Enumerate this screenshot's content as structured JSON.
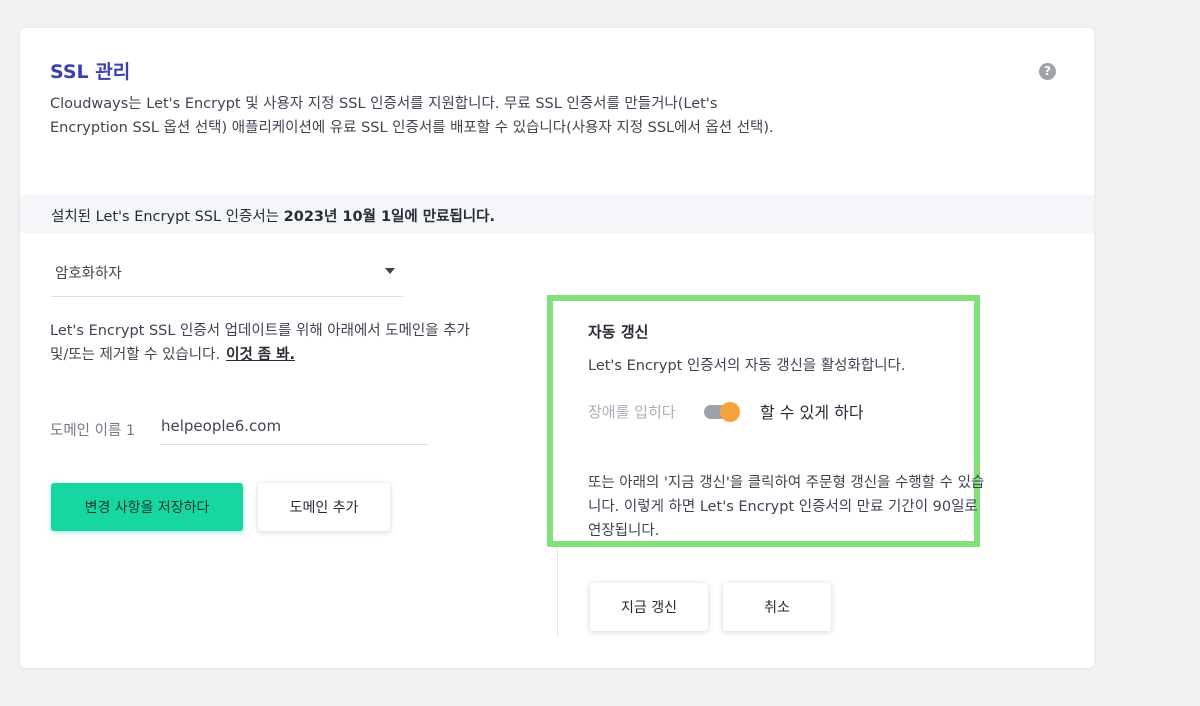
{
  "ssl": {
    "title": "SSL 관리",
    "help_icon": "?",
    "description": "Cloudways는 Let's Encrypt 및 사용자 지정 SSL 인증서를 지원합니다. 무료 SSL 인증서를 만들거나(Let's Encryption SSL 옵션 선택) 애플리케이션에 유료 SSL 인증서를 배포할 수 있습니다(사용자 지정 SSL에서 옵션 선택).",
    "expiry_prefix": "설치된 Let's Encrypt SSL 인증서는 ",
    "expiry_date": "2023년 10월 1일에 만료됩니다."
  },
  "certificate_select": {
    "value": "암호화하자"
  },
  "domains": {
    "help_text": "Let's Encrypt SSL 인증서 업데이트를 위해 아래에서 도메인을 추가 및/또는 제거할 수 있습니다.",
    "see_link": "이것 좀 봐.",
    "label": "도메인 이름 1",
    "value": "helpeople6.com"
  },
  "buttons": {
    "save": "변경 사항을 저장하다",
    "add_domain": "도메인 추가",
    "renew_now": "지금 갱신",
    "cancel": "취소"
  },
  "auto_renew": {
    "title": "자동 갱신",
    "subtitle": "Let's Encrypt 인증서의 자동 갱신을 활성화합니다.",
    "off_label": "장애를 입히다",
    "on_label": "할 수 있게 하다",
    "enabled": true,
    "note": "또는 아래의 '지금 갱신'을 클릭하여 주문형 갱신을 수행할 수 있습니다. 이렇게 하면 Let's Encrypt 인증서의 만료 기간이 90일로 연장됩니다."
  },
  "colors": {
    "title": "#3b3fb0",
    "primary_button": "#16d6a2",
    "toggle_knob": "#f5a13d",
    "highlight_border": "#84e07b",
    "banner_background": "#f4f6fa"
  }
}
